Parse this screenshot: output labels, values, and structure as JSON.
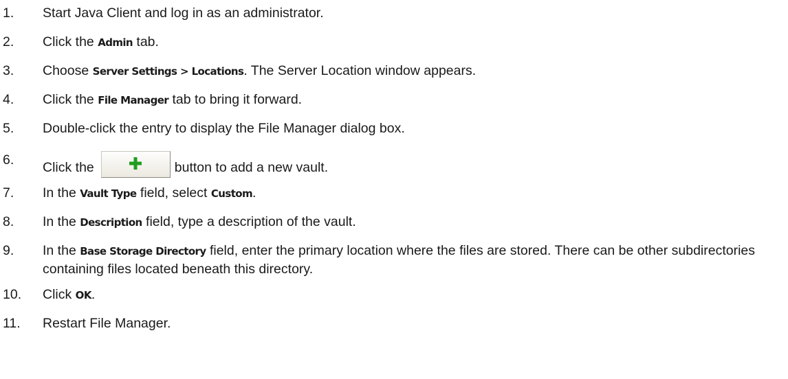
{
  "steps": [
    {
      "number": "1.",
      "parts": [
        {
          "text": "Start Java Client and log in as an administrator."
        }
      ]
    },
    {
      "number": "2.",
      "parts": [
        {
          "text": "Click the "
        },
        {
          "text": "Admin",
          "bold": true
        },
        {
          "text": " tab."
        }
      ]
    },
    {
      "number": "3.",
      "parts": [
        {
          "text": "Choose "
        },
        {
          "text": "Server Settings > Locations",
          "bold": true
        },
        {
          "text": ". The Server Location window appears."
        }
      ]
    },
    {
      "number": "4.",
      "parts": [
        {
          "text": "Click the "
        },
        {
          "text": "File Manager",
          "bold": true
        },
        {
          "text": " tab to bring it forward."
        }
      ]
    },
    {
      "number": "5.",
      "parts": [
        {
          "text": "Double-click the entry to display the File Manager dialog box."
        }
      ]
    },
    {
      "number": "6.",
      "parts": [
        {
          "text": "Click the"
        },
        {
          "button": "add-icon"
        },
        {
          "text": "button to add a new vault."
        }
      ]
    },
    {
      "number": "7.",
      "parts": [
        {
          "text": "In the "
        },
        {
          "text": "Vault Type",
          "bold": true
        },
        {
          "text": " field, select "
        },
        {
          "text": "Custom",
          "bold": true
        },
        {
          "text": "."
        }
      ]
    },
    {
      "number": "8.",
      "parts": [
        {
          "text": "In the "
        },
        {
          "text": "Description",
          "bold": true
        },
        {
          "text": " field, type a description of the vault."
        }
      ]
    },
    {
      "number": "9.",
      "parts": [
        {
          "text": "In the "
        },
        {
          "text": "Base Storage Directory",
          "bold": true
        },
        {
          "text": " field, enter the primary location where the files are stored. There can be other subdirectories containing files located beneath this directory."
        }
      ]
    },
    {
      "number": "10.",
      "parts": [
        {
          "text": "Click "
        },
        {
          "text": "OK",
          "bold": true
        },
        {
          "text": "."
        }
      ]
    },
    {
      "number": "11.",
      "parts": [
        {
          "text": "Restart File Manager."
        }
      ]
    }
  ],
  "colors": {
    "text": "#1a1a1a",
    "add_icon": "#1e9e1e"
  }
}
